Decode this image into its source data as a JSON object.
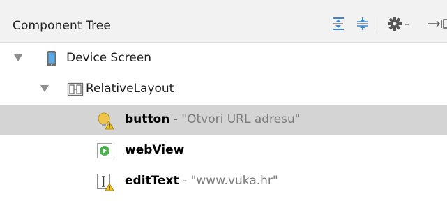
{
  "panel": {
    "title": "Component Tree",
    "toolbar": {
      "expand_icon": "expand-all-icon",
      "collapse_icon": "collapse-all-icon",
      "settings_icon": "gear-icon",
      "hide_icon": "hide-panel-icon"
    }
  },
  "tree": [
    {
      "name": "Device Screen",
      "icon": "phone-icon",
      "expanded": true
    },
    {
      "name": "RelativeLayout",
      "icon": "relative-layout-icon",
      "expanded": true
    },
    {
      "name": "button",
      "separator": " - ",
      "value": "\"Otvori URL adresu\"",
      "icon": "button-icon",
      "warning": true,
      "selected": true
    },
    {
      "name": "webView",
      "icon": "webview-icon"
    },
    {
      "name": "editText",
      "separator": " - ",
      "value": "\"www.vuka.hr\"",
      "icon": "edittext-icon",
      "warning": true
    }
  ],
  "colors": {
    "header_bg": "#f2f2f2",
    "selection_bg": "#d4d4d4",
    "toolbar_blue": "#3d89c9",
    "warning_yellow": "#f5c518",
    "webview_green": "#4caf50"
  }
}
